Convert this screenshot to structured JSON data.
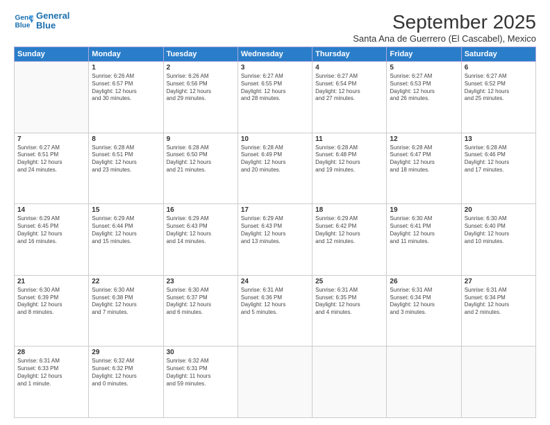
{
  "logo": {
    "line1": "General",
    "line2": "Blue"
  },
  "title": "September 2025",
  "location": "Santa Ana de Guerrero (El Cascabel), Mexico",
  "days": [
    "Sunday",
    "Monday",
    "Tuesday",
    "Wednesday",
    "Thursday",
    "Friday",
    "Saturday"
  ],
  "weeks": [
    [
      {
        "date": "",
        "info": ""
      },
      {
        "date": "1",
        "info": "Sunrise: 6:26 AM\nSunset: 6:57 PM\nDaylight: 12 hours\nand 30 minutes."
      },
      {
        "date": "2",
        "info": "Sunrise: 6:26 AM\nSunset: 6:56 PM\nDaylight: 12 hours\nand 29 minutes."
      },
      {
        "date": "3",
        "info": "Sunrise: 6:27 AM\nSunset: 6:55 PM\nDaylight: 12 hours\nand 28 minutes."
      },
      {
        "date": "4",
        "info": "Sunrise: 6:27 AM\nSunset: 6:54 PM\nDaylight: 12 hours\nand 27 minutes."
      },
      {
        "date": "5",
        "info": "Sunrise: 6:27 AM\nSunset: 6:53 PM\nDaylight: 12 hours\nand 26 minutes."
      },
      {
        "date": "6",
        "info": "Sunrise: 6:27 AM\nSunset: 6:52 PM\nDaylight: 12 hours\nand 25 minutes."
      }
    ],
    [
      {
        "date": "7",
        "info": "Sunrise: 6:27 AM\nSunset: 6:51 PM\nDaylight: 12 hours\nand 24 minutes."
      },
      {
        "date": "8",
        "info": "Sunrise: 6:28 AM\nSunset: 6:51 PM\nDaylight: 12 hours\nand 23 minutes."
      },
      {
        "date": "9",
        "info": "Sunrise: 6:28 AM\nSunset: 6:50 PM\nDaylight: 12 hours\nand 21 minutes."
      },
      {
        "date": "10",
        "info": "Sunrise: 6:28 AM\nSunset: 6:49 PM\nDaylight: 12 hours\nand 20 minutes."
      },
      {
        "date": "11",
        "info": "Sunrise: 6:28 AM\nSunset: 6:48 PM\nDaylight: 12 hours\nand 19 minutes."
      },
      {
        "date": "12",
        "info": "Sunrise: 6:28 AM\nSunset: 6:47 PM\nDaylight: 12 hours\nand 18 minutes."
      },
      {
        "date": "13",
        "info": "Sunrise: 6:28 AM\nSunset: 6:46 PM\nDaylight: 12 hours\nand 17 minutes."
      }
    ],
    [
      {
        "date": "14",
        "info": "Sunrise: 6:29 AM\nSunset: 6:45 PM\nDaylight: 12 hours\nand 16 minutes."
      },
      {
        "date": "15",
        "info": "Sunrise: 6:29 AM\nSunset: 6:44 PM\nDaylight: 12 hours\nand 15 minutes."
      },
      {
        "date": "16",
        "info": "Sunrise: 6:29 AM\nSunset: 6:43 PM\nDaylight: 12 hours\nand 14 minutes."
      },
      {
        "date": "17",
        "info": "Sunrise: 6:29 AM\nSunset: 6:43 PM\nDaylight: 12 hours\nand 13 minutes."
      },
      {
        "date": "18",
        "info": "Sunrise: 6:29 AM\nSunset: 6:42 PM\nDaylight: 12 hours\nand 12 minutes."
      },
      {
        "date": "19",
        "info": "Sunrise: 6:30 AM\nSunset: 6:41 PM\nDaylight: 12 hours\nand 11 minutes."
      },
      {
        "date": "20",
        "info": "Sunrise: 6:30 AM\nSunset: 6:40 PM\nDaylight: 12 hours\nand 10 minutes."
      }
    ],
    [
      {
        "date": "21",
        "info": "Sunrise: 6:30 AM\nSunset: 6:39 PM\nDaylight: 12 hours\nand 8 minutes."
      },
      {
        "date": "22",
        "info": "Sunrise: 6:30 AM\nSunset: 6:38 PM\nDaylight: 12 hours\nand 7 minutes."
      },
      {
        "date": "23",
        "info": "Sunrise: 6:30 AM\nSunset: 6:37 PM\nDaylight: 12 hours\nand 6 minutes."
      },
      {
        "date": "24",
        "info": "Sunrise: 6:31 AM\nSunset: 6:36 PM\nDaylight: 12 hours\nand 5 minutes."
      },
      {
        "date": "25",
        "info": "Sunrise: 6:31 AM\nSunset: 6:35 PM\nDaylight: 12 hours\nand 4 minutes."
      },
      {
        "date": "26",
        "info": "Sunrise: 6:31 AM\nSunset: 6:34 PM\nDaylight: 12 hours\nand 3 minutes."
      },
      {
        "date": "27",
        "info": "Sunrise: 6:31 AM\nSunset: 6:34 PM\nDaylight: 12 hours\nand 2 minutes."
      }
    ],
    [
      {
        "date": "28",
        "info": "Sunrise: 6:31 AM\nSunset: 6:33 PM\nDaylight: 12 hours\nand 1 minute."
      },
      {
        "date": "29",
        "info": "Sunrise: 6:32 AM\nSunset: 6:32 PM\nDaylight: 12 hours\nand 0 minutes."
      },
      {
        "date": "30",
        "info": "Sunrise: 6:32 AM\nSunset: 6:31 PM\nDaylight: 11 hours\nand 59 minutes."
      },
      {
        "date": "",
        "info": ""
      },
      {
        "date": "",
        "info": ""
      },
      {
        "date": "",
        "info": ""
      },
      {
        "date": "",
        "info": ""
      }
    ]
  ]
}
